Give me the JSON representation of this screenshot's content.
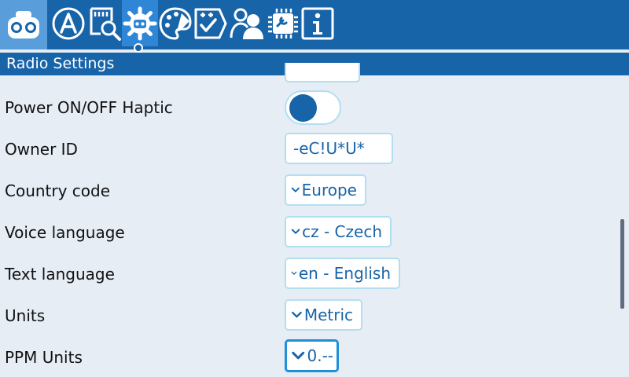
{
  "header": {
    "title": "Radio Settings"
  },
  "tabs": [
    {
      "name": "radio-home-icon",
      "active": false
    },
    {
      "name": "model-select-icon",
      "active": false
    },
    {
      "name": "sd-card-search-icon",
      "active": false
    },
    {
      "name": "radio-settings-gear-icon",
      "active": true
    },
    {
      "name": "theme-palette-icon",
      "active": false
    },
    {
      "name": "checklist-icon",
      "active": false
    },
    {
      "name": "users-icon",
      "active": false
    },
    {
      "name": "hardware-chip-icon",
      "active": false
    },
    {
      "name": "info-icon",
      "active": false
    }
  ],
  "settings": [
    {
      "label": "Power ON/OFF Haptic",
      "control": "toggle",
      "value": "off"
    },
    {
      "label": "Owner ID",
      "control": "text",
      "value": "-eC!U*U*"
    },
    {
      "label": "Country code",
      "control": "dropdown",
      "value": "Europe"
    },
    {
      "label": "Voice language",
      "control": "dropdown",
      "value": "cz - Czech"
    },
    {
      "label": "Text language",
      "control": "dropdown",
      "value": "en - English"
    },
    {
      "label": "Units",
      "control": "dropdown",
      "value": "Metric"
    },
    {
      "label": "PPM Units",
      "control": "dropdown",
      "value": "0.--"
    }
  ],
  "colors": {
    "header_blue": "#1864a8",
    "active_tab": "#2f86d6",
    "field_border": "#b3def2",
    "focus_border": "#1e90d8",
    "background": "#e6edf5"
  }
}
